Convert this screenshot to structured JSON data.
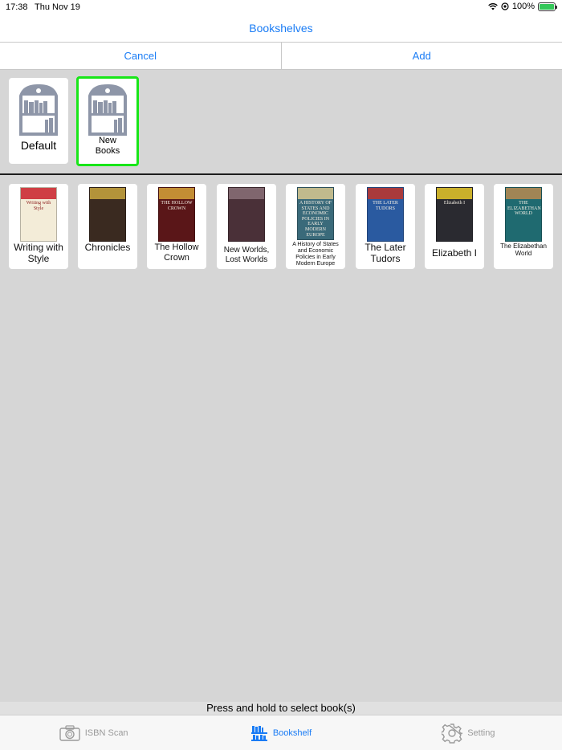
{
  "status_bar": {
    "time": "17:38",
    "date": "Thu Nov 19",
    "battery": "100%",
    "battery_level": 1.0
  },
  "nav": {
    "title": "Bookshelves"
  },
  "actions": {
    "cancel_label": "Cancel",
    "add_label": "Add"
  },
  "shelves": [
    {
      "label": "Default",
      "selected": false
    },
    {
      "label": "New Books",
      "selected": true
    }
  ],
  "books": [
    {
      "title": "Writing with Style",
      "cover_color": "#f3ecd8",
      "cover_text": "Writing with Style",
      "accent": "#c8202a"
    },
    {
      "title": "Chronicles",
      "cover_color": "#3a2a20",
      "cover_text": "",
      "accent": "#c9a640"
    },
    {
      "title": "The Hollow Crown",
      "cover_color": "#5a1618",
      "cover_text": "THE HOLLOW CROWN",
      "accent": "#d6a23a"
    },
    {
      "title": "New Worlds, Lost Worlds",
      "cover_color": "#4a3038",
      "cover_text": "",
      "accent": "#8a7078"
    },
    {
      "title": "A History of States and Economic Policies in Early Modern Europe",
      "cover_color": "#3a6a7a",
      "cover_text": "A HISTORY OF STATES AND ECONOMIC POLICIES IN EARLY MODERN EUROPE",
      "accent": "#d8c890"
    },
    {
      "title": "The Later Tudors",
      "cover_color": "#2a5aa0",
      "cover_text": "THE LATER TUDORS",
      "accent": "#c0352a"
    },
    {
      "title": "Elizabeth I",
      "cover_color": "#2a2a30",
      "cover_text": "Elizabeth I",
      "accent": "#e6c82a"
    },
    {
      "title": "The Elizabethan World",
      "cover_color": "#1f6a70",
      "cover_text": "THE ELIZABETHAN WORLD",
      "accent": "#b88a50"
    }
  ],
  "hint": "Press and hold to select book(s)",
  "tabs": [
    {
      "label": "ISBN Scan",
      "icon": "camera-icon",
      "active": false
    },
    {
      "label": "Bookshelf",
      "icon": "bookshelf-icon",
      "active": true
    },
    {
      "label": "Setting",
      "icon": "gear-icon",
      "active": false
    }
  ]
}
